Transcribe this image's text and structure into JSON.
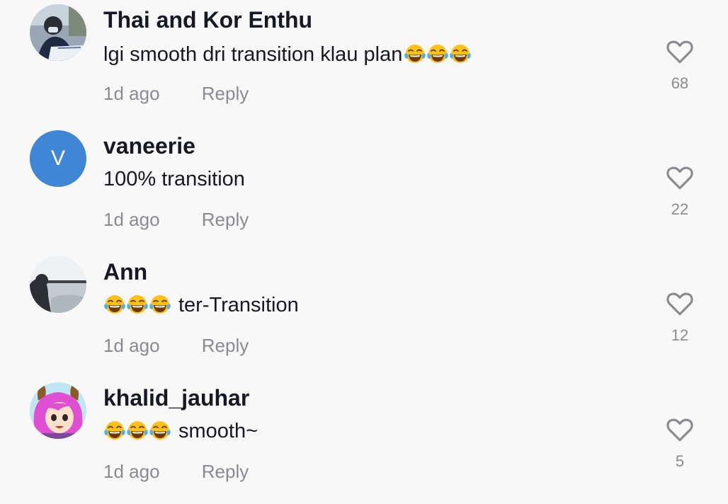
{
  "comments": [
    {
      "username": "Thai and Kor Enthu",
      "text": "lgi smooth dri transition klau plan",
      "emoji": "😂😂😂",
      "time": "1d ago",
      "reply": "Reply",
      "likes": "68",
      "avatar": "photo"
    },
    {
      "username": "vaneerie",
      "text": "100% transition",
      "time": "1d ago",
      "reply": "Reply",
      "likes": "22",
      "avatar_letter": "V",
      "avatar_color": "#3f86d4"
    },
    {
      "username": "Ann",
      "text": "ter-Transition",
      "emoji": "😂😂😂",
      "time": "1d ago",
      "reply": "Reply",
      "likes": "12",
      "avatar": "photo"
    },
    {
      "username": "khalid_jauhar",
      "text": "smooth~",
      "emoji": "😂😂😂",
      "time": "1d ago",
      "reply": "Reply",
      "likes": "5",
      "avatar": "cartoon"
    }
  ],
  "icons": {
    "like": "heart-outline-icon",
    "emoji": "tears-of-joy-emoji"
  },
  "colors": {
    "background": "#f8f8f8",
    "text": "#161823",
    "secondary": "#8a8b91"
  }
}
